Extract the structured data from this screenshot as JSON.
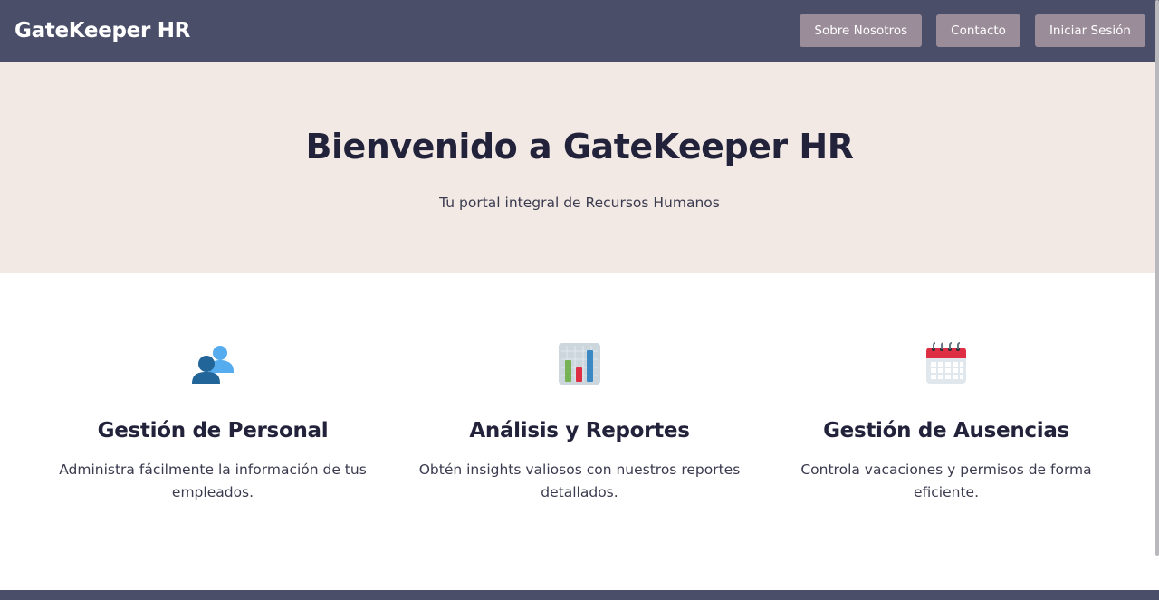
{
  "navbar": {
    "brand": "GateKeeper HR",
    "buttons": [
      "Sobre Nosotros",
      "Contacto",
      "Iniciar Sesión"
    ]
  },
  "hero": {
    "title": "Bienvenido a GateKeeper HR",
    "subtitle": "Tu portal integral de Recursos Humanos"
  },
  "features": [
    {
      "icon": "people-icon",
      "title": "Gestión de Personal",
      "description": "Administra fácilmente la información de tus empleados."
    },
    {
      "icon": "bar-chart-icon",
      "title": "Análisis y Reportes",
      "description": "Obtén insights valiosos con nuestros reportes detallados."
    },
    {
      "icon": "calendar-icon",
      "title": "Gestión de Ausencias",
      "description": "Controla vacaciones y permisos de forma eficiente."
    }
  ],
  "colors": {
    "navbar": "#4a4e69",
    "button": "#9a8c98",
    "hero_bg": "#f2e9e4",
    "heading": "#22223b"
  }
}
